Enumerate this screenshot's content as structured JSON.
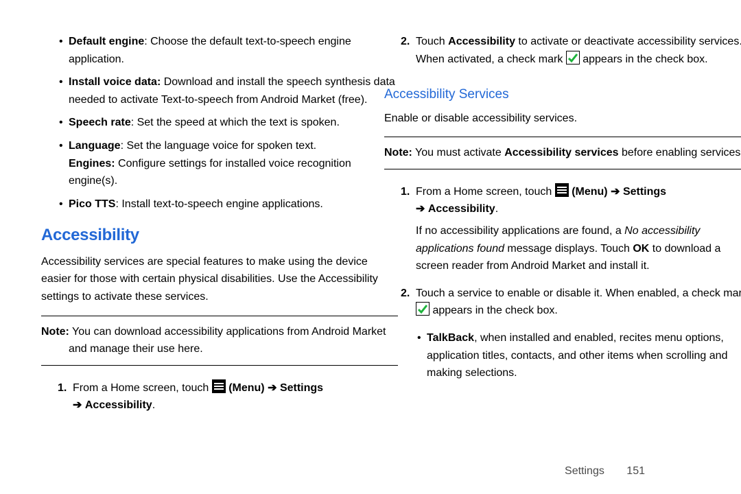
{
  "left": {
    "bullets": {
      "default_engine": {
        "label": "Default engine",
        "text": ": Choose the default text-to-speech engine application."
      },
      "install_voice": {
        "label": "Install voice data:",
        "text": " Download and install the speech synthesis data needed to activate Text-to-speech from Android Market (free)."
      },
      "speech_rate": {
        "label": "Speech rate",
        "text": ": Set the speed at which the text is spoken."
      },
      "language": {
        "label": "Language",
        "text": ": Set the language voice for spoken text."
      },
      "engines": {
        "label": "Engines:",
        "text": " Configure settings for installed voice recognition engine(s)."
      },
      "pico": {
        "label": "Pico TTS",
        "text": ": Install text-to-speech engine applications."
      }
    },
    "heading": "Accessibility",
    "intro": "Accessibility services are special features to make using the device easier for those with certain physical disabilities. Use the Accessibility settings to activate these services.",
    "note_label": "Note:",
    "note_text": " You can download accessibility applications from Android Market and manage their use here.",
    "step1_num": "1.",
    "step1_a": "From a Home screen, touch ",
    "step1_menu": " (Menu) ",
    "step1_arrow": "➔",
    "step1_settings": " Settings ",
    "step1_accessibility": " Accessibility",
    "step1_period": "."
  },
  "right": {
    "step2_num": "2.",
    "step2_a": "Touch ",
    "step2_b": "Accessibility",
    "step2_c": " to activate or deactivate accessibility services. When activated, a check mark ",
    "step2_d": " appears in the check box.",
    "subhead": "Accessibility Services",
    "intro": "Enable or disable accessibility services.",
    "note_label": "Note:",
    "note_a": " You must activate ",
    "note_b": "Accessibility services",
    "note_c": " before enabling services.",
    "s1_num": "1.",
    "s1_a": "From a Home screen, touch ",
    "s1_menu": " (Menu) ",
    "s1_arrow": "➔",
    "s1_settings": " Settings ",
    "s1_accessibility": " Accessibility",
    "s1_period": ".",
    "s1_p2a": "If no accessibility applications are found, a ",
    "s1_p2b": "No accessibility applications found",
    "s1_p2c": " message displays. Touch ",
    "s1_p2d": "OK",
    "s1_p2e": " to download a screen reader from Android Market and install it.",
    "s2_num": "2.",
    "s2_a": "Touch a service to enable or disable it. When enabled, a check mark ",
    "s2_b": " appears in the check box.",
    "talkback_label": "TalkBack",
    "talkback_text": ", when installed and enabled, recites menu options, application titles, contacts, and other items when scrolling and making selections."
  },
  "footer": {
    "section": "Settings",
    "page": "151"
  }
}
